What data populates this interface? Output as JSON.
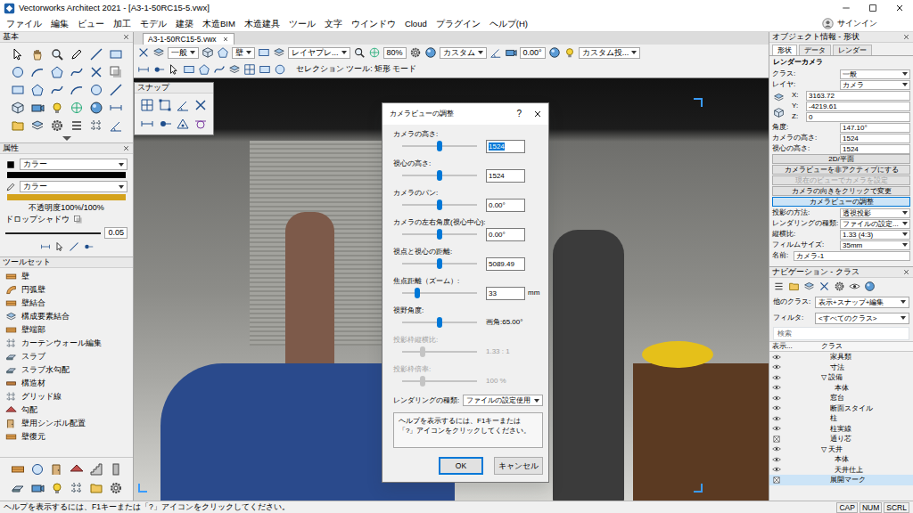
{
  "window": {
    "title": "Vectorworks Architect 2021 - [A3-1-50RC15-5.vwx]"
  },
  "menu": [
    "ファイル",
    "編集",
    "ビュー",
    "加工",
    "モデル",
    "建築",
    "木造BIM",
    "木造建具",
    "ツール",
    "文字",
    "ウインドウ",
    "Cloud",
    "プラグイン",
    "ヘルプ(H)"
  ],
  "account": {
    "label": "サインイン"
  },
  "basic_palette": {
    "title": "基本"
  },
  "attributes": {
    "title": "属性",
    "fill": {
      "label": "カラー",
      "color": "#000000"
    },
    "pen": {
      "label": "カラー",
      "color": "#d4a21c"
    },
    "opacity": "不透明度100%/100%",
    "shadow": "ドロップシャドウ",
    "thickness": "0.05"
  },
  "toolset": {
    "title": "ツールセット",
    "items": [
      {
        "label": "壁",
        "selected": false
      },
      {
        "label": "円弧壁",
        "selected": false
      },
      {
        "label": "壁結合",
        "selected": false
      },
      {
        "label": "構成要素結合",
        "selected": false
      },
      {
        "label": "壁端部",
        "selected": false
      },
      {
        "label": "カーテンウォール編集",
        "selected": false
      },
      {
        "label": "スラブ",
        "selected": false
      },
      {
        "label": "スラブ水勾配",
        "selected": false
      },
      {
        "label": "構造材",
        "selected": false
      },
      {
        "label": "グリッド線",
        "selected": false
      },
      {
        "label": "勾配",
        "selected": false
      },
      {
        "label": "壁用シンボル配置",
        "selected": false
      },
      {
        "label": "壁復元",
        "selected": false
      }
    ]
  },
  "document_tab": {
    "label": "A3-1-50RC15-5.vwx",
    "selected": true
  },
  "view_bar": [
    {
      "kind": "select",
      "value": "一般"
    },
    {
      "kind": "select",
      "value": "壁"
    },
    {
      "kind": "select",
      "value": "レイヤプレ..."
    },
    {
      "kind": "field",
      "value": "80%"
    },
    {
      "kind": "select",
      "value": "カスタム"
    },
    {
      "kind": "field",
      "value": "0.00°"
    },
    {
      "kind": "select",
      "value": "カスタム投..."
    }
  ],
  "mode_bar": {
    "hint": "セレクション ツール: 矩形 モード"
  },
  "snap_palette": {
    "title": "スナップ"
  },
  "dialog": {
    "title": "カメラビューの調整",
    "help_button": "?",
    "sliders": [
      {
        "label": "カメラの高さ:",
        "level": 0.5,
        "value": "1524",
        "kind": "input",
        "disabled": false,
        "selected": true
      },
      {
        "label": "視心の高さ:",
        "level": 0.5,
        "value": "1524",
        "kind": "input",
        "disabled": false,
        "selected": false
      },
      {
        "label": "カメラのパン:",
        "level": 0.5,
        "value": "0.00°",
        "kind": "input",
        "disabled": false,
        "selected": false
      },
      {
        "label": "カメラの左右角度(視心中心):",
        "level": 0.5,
        "value": "0.00°",
        "kind": "input",
        "disabled": false,
        "selected": false
      },
      {
        "label": "視点と視心の距離:",
        "level": 0.5,
        "value": "5089.49",
        "kind": "input",
        "disabled": false,
        "selected": false
      },
      {
        "label": "焦点距離（ズーム）:",
        "level": 0.2,
        "value": "33",
        "unit": "mm",
        "kind": "input",
        "disabled": false,
        "selected": false
      },
      {
        "label": "視野角度:",
        "level": 0.5,
        "value": "画角:65.00°",
        "kind": "readout",
        "disabled": false,
        "selected": false
      },
      {
        "label": "投影枠縦横比:",
        "level": 0.27,
        "value": "1.33 : 1",
        "kind": "readout",
        "disabled": true,
        "selected": false
      },
      {
        "label": "投影枠倍率:",
        "level": 0.27,
        "value": "100 %",
        "kind": "readout",
        "disabled": true,
        "selected": false
      }
    ],
    "render_label": "レンダリングの種類:",
    "render_value": "ファイルの設定使用",
    "help": "ヘルプを表示するには、F1キーまたは「?」アイコンをクリックしてください。",
    "buttons": [
      {
        "label": "OK",
        "selected": true
      },
      {
        "label": "キャンセル",
        "selected": false
      }
    ]
  },
  "object_info": {
    "title": "オブジェクト情報 - 形状",
    "tabs": [
      {
        "label": "形状",
        "selected": true
      },
      {
        "label": "データ",
        "selected": false
      },
      {
        "label": "レンダー",
        "selected": false
      }
    ],
    "heading": "レンダーカメラ",
    "fields": [
      {
        "label": "クラス:",
        "value": "一般"
      },
      {
        "label": "レイヤ:",
        "value": "カメラ"
      }
    ],
    "coords": [
      {
        "label": "X:",
        "value": "3163.72"
      },
      {
        "label": "Y:",
        "value": "-4219.61"
      },
      {
        "label": "Z:",
        "value": "0"
      }
    ],
    "props": [
      {
        "label": "角度:",
        "value": "147.10°"
      },
      {
        "label": "カメラの高さ:",
        "value": "1524"
      },
      {
        "label": "視心の高さ:",
        "value": "1524"
      }
    ],
    "buttons": [
      {
        "label": "2D/平面",
        "disabled": false,
        "selected": false
      },
      {
        "label": "カメラビューを非アクティブにする",
        "disabled": false,
        "selected": false
      },
      {
        "label": "現在のビューでカメラを設定",
        "disabled": true,
        "selected": false
      },
      {
        "label": "カメラの向きをクリックで変更",
        "disabled": false,
        "selected": false
      },
      {
        "label": "カメラビューの調整",
        "disabled": false,
        "selected": true
      }
    ],
    "options": [
      {
        "label": "投影の方法:",
        "value": "透視投影"
      },
      {
        "label": "レンダリングの種類:",
        "value": "ファイルの設定..."
      },
      {
        "label": "縦横比:",
        "value": "1.33 (4:3)"
      },
      {
        "label": "フィルムサイズ:",
        "value": "35mm"
      }
    ],
    "name": {
      "label": "名前:",
      "value": "カメラ-1"
    }
  },
  "navigation": {
    "title": "ナビゲーション - クラス",
    "other_label": "他のクラス:",
    "other_value": "表示+スナップ+編集",
    "filter_label": "フィルタ:",
    "filter_value": "<すべてのクラス>",
    "search_placeholder": "検索",
    "columns": [
      "表示...",
      "クラス"
    ],
    "rows": [
      {
        "label": "家具類",
        "depth": 0,
        "expanded": false,
        "visible": true,
        "selected": false
      },
      {
        "label": "寸法",
        "depth": 0,
        "expanded": false,
        "visible": true,
        "selected": false
      },
      {
        "label": "設備",
        "depth": 0,
        "toggle": "▽",
        "expanded": true,
        "visible": true,
        "selected": false
      },
      {
        "label": "本体",
        "depth": 1,
        "expanded": false,
        "visible": true,
        "selected": false
      },
      {
        "label": "窓台",
        "depth": 0,
        "expanded": false,
        "visible": true,
        "selected": false
      },
      {
        "label": "断面スタイル",
        "depth": 0,
        "expanded": false,
        "visible": true,
        "selected": false
      },
      {
        "label": "柱",
        "depth": 0,
        "expanded": false,
        "visible": true,
        "selected": false
      },
      {
        "label": "柱実線",
        "depth": 0,
        "expanded": false,
        "visible": true,
        "selected": false
      },
      {
        "label": "通り芯",
        "depth": 0,
        "expanded": false,
        "visible": false,
        "selected": false
      },
      {
        "label": "天井",
        "depth": 0,
        "toggle": "▽",
        "expanded": true,
        "visible": true,
        "selected": false
      },
      {
        "label": "本体",
        "depth": 1,
        "expanded": false,
        "visible": true,
        "selected": false
      },
      {
        "label": "天井仕上",
        "depth": 1,
        "expanded": false,
        "visible": true,
        "selected": false
      },
      {
        "label": "展開マーク",
        "depth": 0,
        "expanded": false,
        "visible": false,
        "selected": true
      }
    ]
  },
  "status_bar": {
    "text": "ヘルプを表示するには、F1キーまたは「?」アイコンをクリックしてください。",
    "indicators": [
      "CAP",
      "NUM",
      "SCRL"
    ]
  }
}
